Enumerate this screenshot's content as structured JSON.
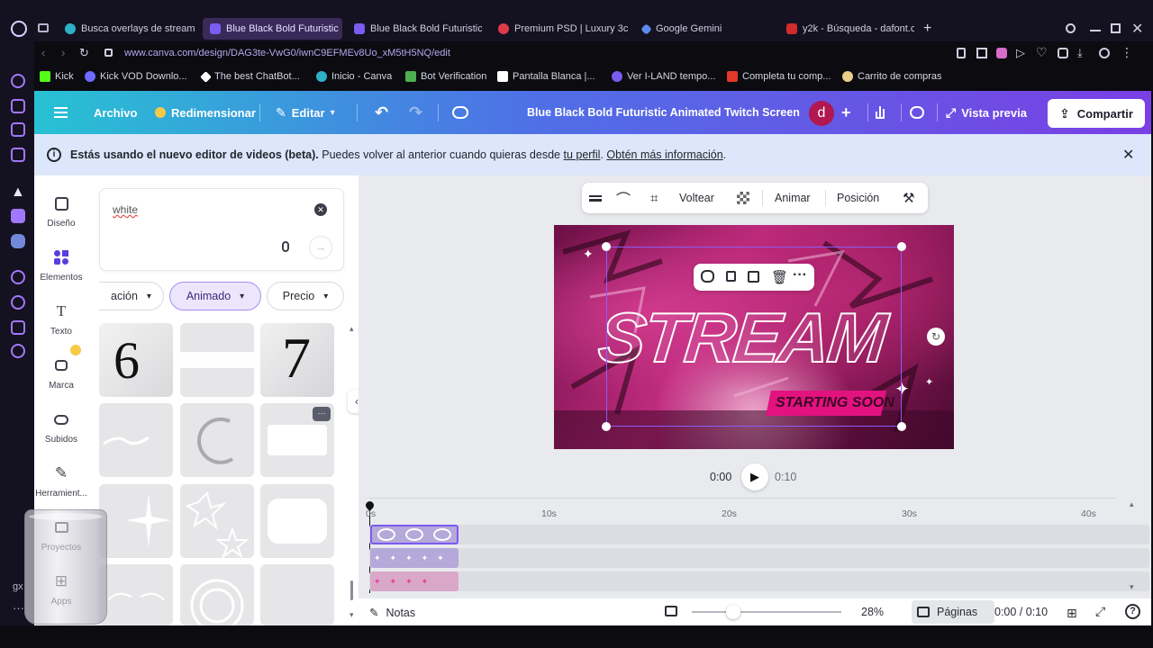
{
  "browser": {
    "tabs": [
      {
        "label": "Busca overlays de stream",
        "color": "#2fb0c9",
        "active": false
      },
      {
        "label": "Blue Black Bold Futuristic",
        "color": "#7a5cf0",
        "active": true
      },
      {
        "label": "Blue Black Bold Futuristic",
        "color": "#7a5cf0",
        "active": false
      },
      {
        "label": "Premium PSD | Luxury 3c",
        "color": "#e03a4a",
        "active": false
      },
      {
        "label": "Google Gemini",
        "color": "#5c8cf0",
        "active": false
      },
      {
        "label": "y2k - Búsqueda - dafont.c",
        "color": "#d22b2b",
        "active": false
      }
    ],
    "new_tab": "+",
    "url": "www.canva.com/design/DAG3te-VwG0/iwnC9EFMEv8Uo_xM5tH5NQ/edit",
    "bookmarks": [
      {
        "label": "Kick",
        "color": "#53fc18"
      },
      {
        "label": "Kick VOD Downlo...",
        "color": "#6c6cff"
      },
      {
        "label": "The best ChatBot...",
        "color": "#ffffff"
      },
      {
        "label": "Inicio - Canva",
        "color": "#2fb0c9"
      },
      {
        "label": "Bot Verification",
        "color": "#4caf50"
      },
      {
        "label": "Pantalla Blanca |...",
        "color": "#ffffff"
      },
      {
        "label": "Ver I-LAND tempo...",
        "color": "#7a5cf0"
      },
      {
        "label": "Completa tu comp...",
        "color": "#e0392b"
      },
      {
        "label": "Carrito de compras",
        "color": "#e8d08a"
      }
    ]
  },
  "canva_header": {
    "menu_icon": "hamburger-icon",
    "archivo": "Archivo",
    "redimensionar": "Redimensionar",
    "editar": "Editar",
    "title": "Blue Black Bold Futuristic Animated Twitch Screen",
    "avatar_letter": "d",
    "preview": "Vista previa",
    "share": "Compartir"
  },
  "banner": {
    "bold": "Estás usando el nuevo editor de videos (beta).",
    "text": " Puedes volver al anterior cuando quieras desde ",
    "link1": "tu perfil",
    "sep": ". ",
    "link2": "Obtén más información",
    "end": "."
  },
  "rail": [
    {
      "label": "Diseño",
      "icon": "layout-icon"
    },
    {
      "label": "Elementos",
      "icon": "elements-icon"
    },
    {
      "label": "Texto",
      "icon": "text-icon"
    },
    {
      "label": "Marca",
      "icon": "brand-icon"
    },
    {
      "label": "Subidos",
      "icon": "upload-icon"
    },
    {
      "label": "Herramient...",
      "icon": "tools-icon"
    },
    {
      "label": "Proyectos",
      "icon": "folder-icon"
    },
    {
      "label": "Apps",
      "icon": "apps-icon"
    }
  ],
  "panel": {
    "search_value": "white",
    "chips": [
      "ación",
      "Animado",
      "Precio"
    ],
    "tile_text_6": "6",
    "tile_text_7": "7"
  },
  "toolbar": {
    "voltear": "Voltear",
    "animar": "Animar",
    "posicion": "Posición"
  },
  "design": {
    "headline": "STREAM",
    "subline": "STARTING SOON"
  },
  "player": {
    "current": "0:00",
    "total": "0:10"
  },
  "timeline": {
    "ticks": [
      "0s",
      "10s",
      "20s",
      "30s",
      "40s"
    ]
  },
  "footer": {
    "notes": "Notas",
    "zoom": "28%",
    "pages": "Páginas",
    "time": "0:00 / 0:10"
  },
  "misc": {
    "sidebar_gx": "gx"
  }
}
